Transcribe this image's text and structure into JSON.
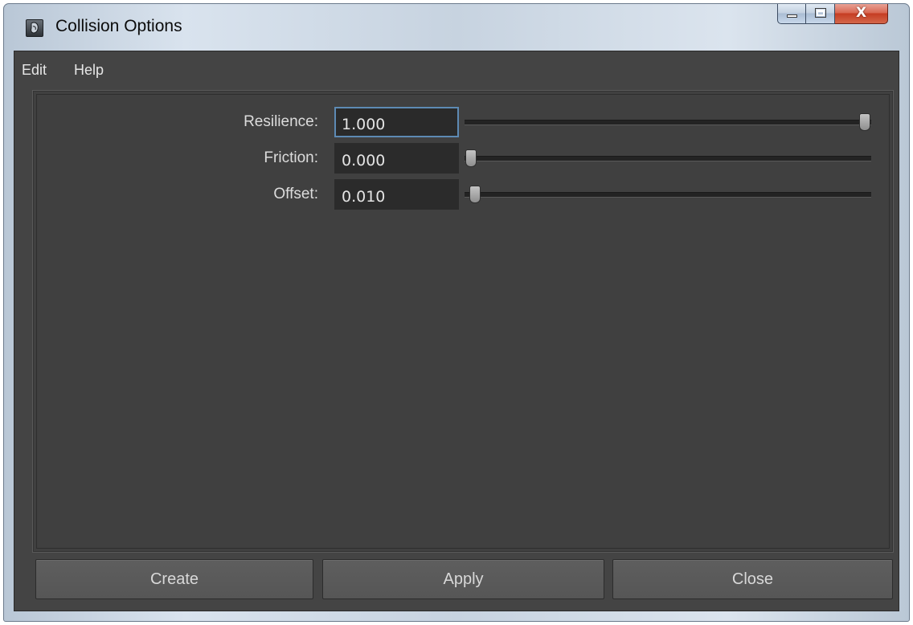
{
  "window": {
    "title": "Collision Options",
    "icon": "maya-app-icon",
    "caption_buttons": {
      "minimize_icon": "minimize-icon",
      "maximize_icon": "maximize-icon",
      "close_icon": "close-icon",
      "close_glyph": "X"
    }
  },
  "menu": {
    "items": [
      {
        "label": "Edit"
      },
      {
        "label": "Help"
      }
    ]
  },
  "fields": [
    {
      "label": "Resilience:",
      "value": "1.000",
      "slider_fraction": 1.0,
      "focused": true
    },
    {
      "label": "Friction:",
      "value": "0.000",
      "slider_fraction": 0.0,
      "focused": false
    },
    {
      "label": "Offset:",
      "value": "0.010",
      "slider_fraction": 0.01,
      "focused": false
    }
  ],
  "buttons": {
    "create": "Create",
    "apply": "Apply",
    "close": "Close"
  },
  "colors": {
    "background": "#444444",
    "focus_border": "#5d8ab4",
    "close_button": "#c53c22"
  }
}
